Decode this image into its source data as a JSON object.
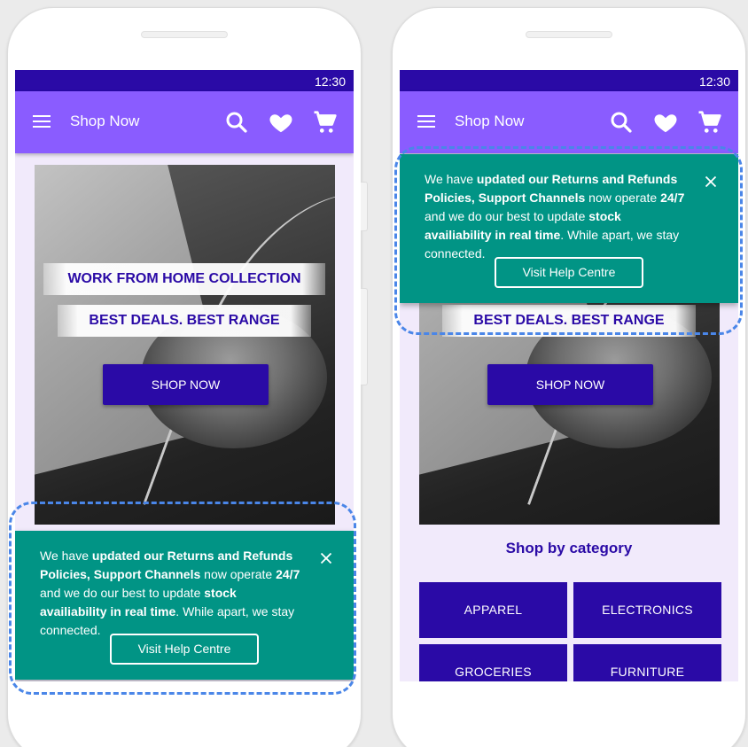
{
  "status_time": "12:30",
  "appbar": {
    "title": "Shop Now",
    "menu_icon": "menu-icon",
    "search_icon": "search-icon",
    "favorite_icon": "heart-icon",
    "cart_icon": "cart-icon"
  },
  "hero": {
    "headline": "WORK FROM HOME COLLECTION",
    "subheadline": "BEST DEALS. BEST RANGE",
    "cta": "SHOP NOW"
  },
  "snackbar": {
    "message_parts": [
      {
        "text": "We have ",
        "bold": false
      },
      {
        "text": "updated our Returns and Refunds Policies, Support Channels",
        "bold": true
      },
      {
        "text": " now operate ",
        "bold": false
      },
      {
        "text": "24/7",
        "bold": true
      },
      {
        "text": " and we do our best to update ",
        "bold": false
      },
      {
        "text": "stock availiability in real time",
        "bold": true
      },
      {
        "text": ". While apart, we stay connected.",
        "bold": false
      }
    ],
    "action": "Visit Help Centre",
    "close_icon": "close-icon"
  },
  "category": {
    "title": "Shop by category",
    "items": [
      "APPAREL",
      "ELECTRONICS",
      "GROCERIES",
      "FURNITURE"
    ]
  },
  "colors": {
    "status_bar": "#2a0aa6",
    "app_bar": "#8a5cff",
    "primary": "#2a0aa6",
    "snackbar": "#019485",
    "highlight_dash": "#4a86e8",
    "screen_bg": "#f1eafb"
  }
}
